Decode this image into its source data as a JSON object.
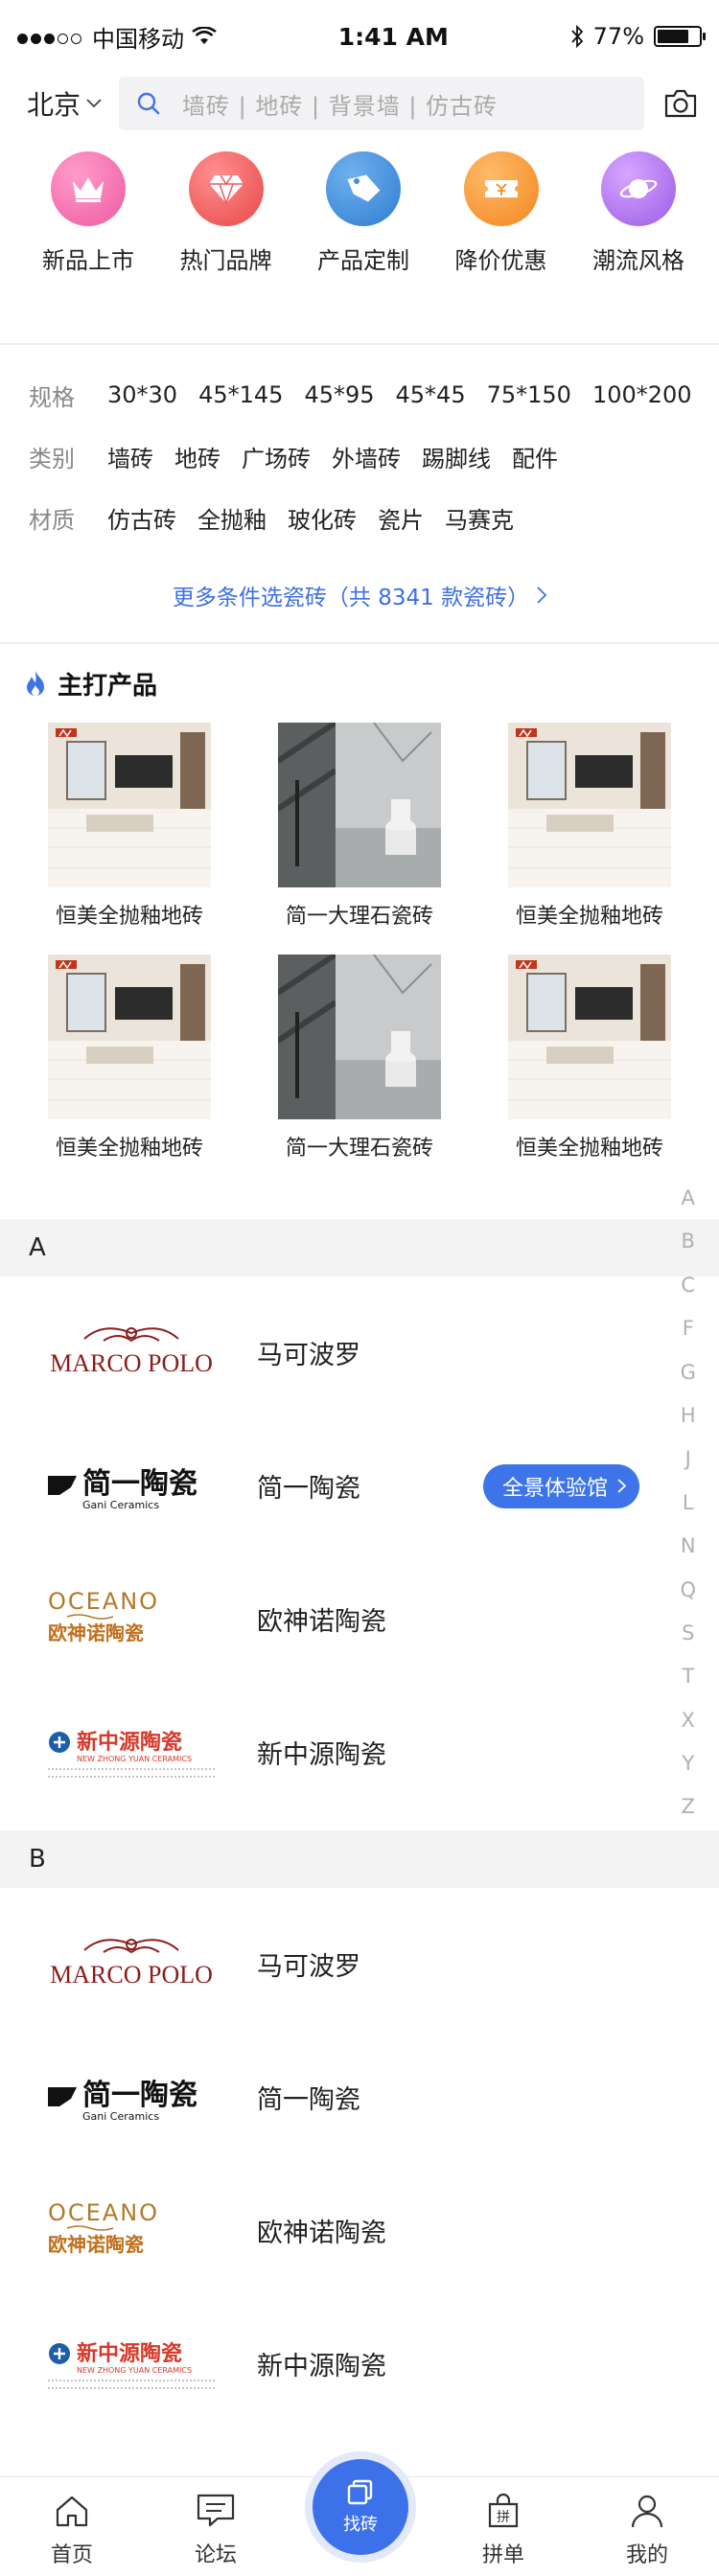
{
  "status": {
    "carrier": "中国移动",
    "time": "1:41 AM",
    "battery": "77%",
    "battery_level": 0.77
  },
  "search": {
    "city": "北京",
    "placeholder": "墙砖 | 地砖 | 背景墙 | 仿古砖"
  },
  "categories": [
    {
      "label": "新品上市",
      "icon": "crown-icon",
      "color": "#f06aa6"
    },
    {
      "label": "热门品牌",
      "icon": "diamond-icon",
      "color": "#ef5a5a"
    },
    {
      "label": "产品定制",
      "icon": "tag-icon",
      "color": "#3f8fdb"
    },
    {
      "label": "降价优惠",
      "icon": "coupon-icon",
      "color": "#f59531"
    },
    {
      "label": "潮流风格",
      "icon": "planet-icon",
      "color": "#b076ee"
    }
  ],
  "filters": {
    "spec": {
      "label": "规格",
      "values": [
        "30*30",
        "45*145",
        "45*95",
        "45*45",
        "75*150",
        "100*200"
      ]
    },
    "type": {
      "label": "类别",
      "values": [
        "墙砖",
        "地砖",
        "广场砖",
        "外墙砖",
        "踢脚线",
        "配件"
      ]
    },
    "material": {
      "label": "材质",
      "values": [
        "仿古砖",
        "全抛釉",
        "玻化砖",
        "瓷片",
        "马赛克"
      ]
    },
    "more": "更多条件选瓷砖（共 8341 款瓷砖）"
  },
  "featured": {
    "title": "主打产品",
    "products": [
      {
        "name": "恒美全抛釉地砖",
        "image": "living"
      },
      {
        "name": "简一大理石瓷砖",
        "image": "bath"
      },
      {
        "name": "恒美全抛釉地砖",
        "image": "living"
      },
      {
        "name": "恒美全抛釉地砖",
        "image": "living"
      },
      {
        "name": "简一大理石瓷砖",
        "image": "bath"
      },
      {
        "name": "恒美全抛釉地砖",
        "image": "living"
      }
    ]
  },
  "alphabet": [
    "A",
    "B",
    "C",
    "F",
    "G",
    "H",
    "J",
    "L",
    "N",
    "Q",
    "S",
    "T",
    "X",
    "Y",
    "Z"
  ],
  "sections": [
    {
      "letter": "A",
      "brands": [
        {
          "name": "马可波罗",
          "logo_text": "MARCO POLO"
        },
        {
          "name": "简一陶瓷",
          "logo_text": "简一陶瓷",
          "logo_sub": "Gani Ceramics",
          "button": "全景体验馆"
        },
        {
          "name": "欧神诺陶瓷",
          "logo_text": "OCEANO",
          "logo_sub": "欧神诺陶瓷"
        },
        {
          "name": "新中源陶瓷",
          "logo_text": "新中源陶瓷",
          "logo_sub": "NEW ZHONG YUAN CERAMICS"
        }
      ]
    },
    {
      "letter": "B",
      "brands": [
        {
          "name": "马可波罗",
          "logo_text": "MARCO POLO"
        },
        {
          "name": "简一陶瓷",
          "logo_text": "简一陶瓷",
          "logo_sub": "Gani Ceramics"
        },
        {
          "name": "欧神诺陶瓷",
          "logo_text": "OCEANO",
          "logo_sub": "欧神诺陶瓷"
        },
        {
          "name": "新中源陶瓷",
          "logo_text": "新中源陶瓷",
          "logo_sub": "NEW ZHONG YUAN CERAMICS"
        }
      ]
    }
  ],
  "tabbar": [
    {
      "label": "首页",
      "icon": "home-icon"
    },
    {
      "label": "论坛",
      "icon": "message-icon"
    },
    {
      "label": "找砖",
      "icon": "tile-icon"
    },
    {
      "label": "拼单",
      "icon": "bag-icon"
    },
    {
      "label": "我的",
      "icon": "user-icon"
    }
  ]
}
